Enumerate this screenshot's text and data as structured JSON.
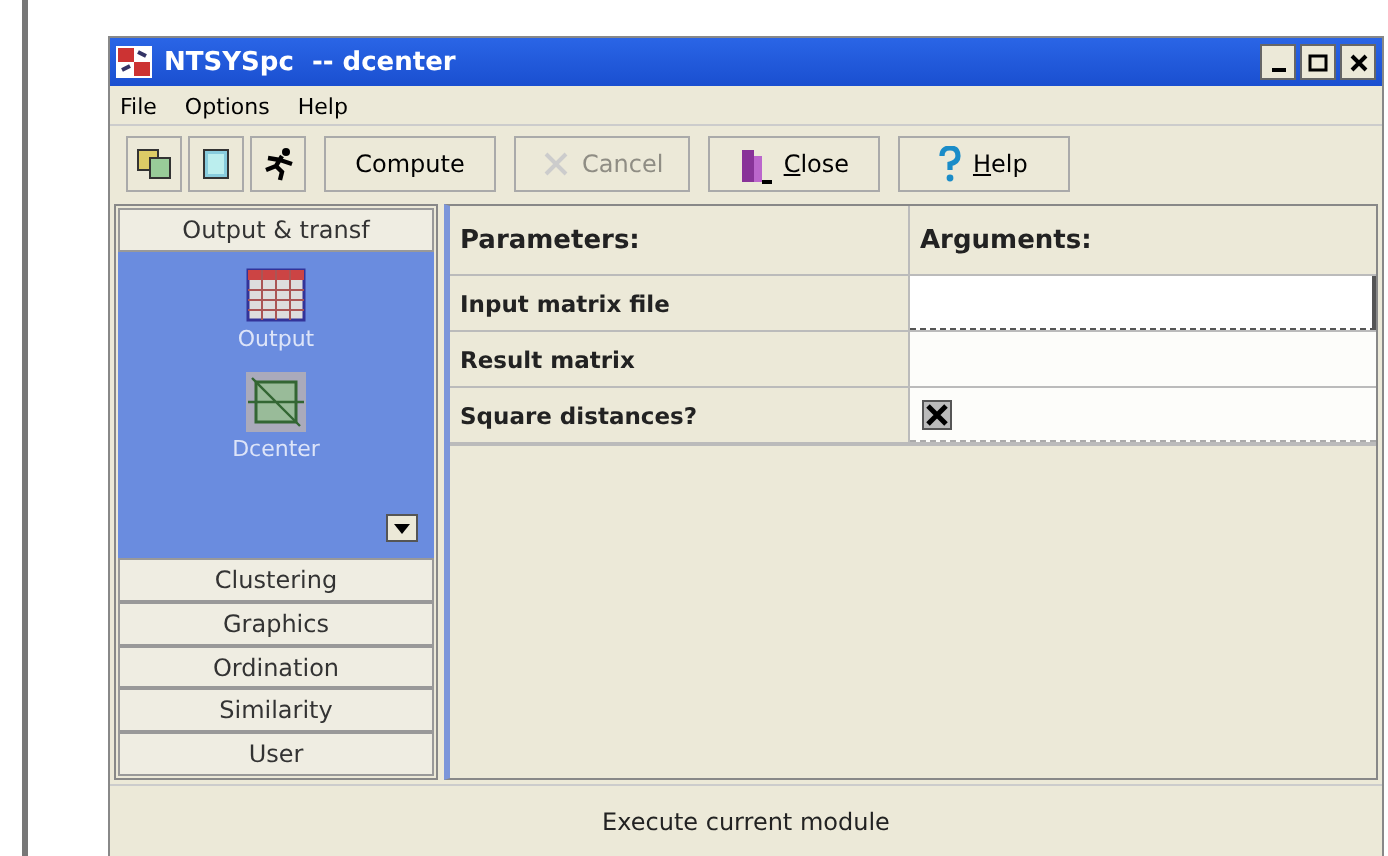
{
  "window": {
    "title": "NTSYSpc  -- dcenter"
  },
  "menu": [
    "File",
    "Options",
    "Help"
  ],
  "toolbar": {
    "icon_buttons": [
      {
        "kind": "copy"
      },
      {
        "kind": "notes"
      },
      {
        "kind": "run"
      }
    ],
    "buttons": [
      {
        "label": "Compute",
        "kind": "plain",
        "disabled": false,
        "underline_first": false
      },
      {
        "label": "Cancel",
        "kind": "cancel",
        "disabled": true,
        "underline_first": false
      },
      {
        "label": "Close",
        "kind": "close",
        "disabled": false,
        "underline_first": true
      },
      {
        "label": "Help",
        "kind": "help",
        "disabled": false,
        "underline_first": true
      }
    ]
  },
  "sidebar": {
    "groups": [
      {
        "label": "Output & transf",
        "expanded": true,
        "items": [
          {
            "label": "Output",
            "kind": "grid"
          },
          {
            "label": "Dcenter",
            "kind": "dcenter"
          }
        ]
      },
      {
        "label": "Clustering",
        "expanded": false
      },
      {
        "label": "Graphics",
        "expanded": false
      },
      {
        "label": "Ordination",
        "expanded": false
      },
      {
        "label": "Similarity",
        "expanded": false
      },
      {
        "label": "User",
        "expanded": false
      }
    ]
  },
  "table": {
    "columns": [
      "Parameters:",
      "Arguments:"
    ],
    "rows": [
      {
        "parameter": "Input matrix file",
        "kind": "field",
        "focused": true
      },
      {
        "parameter": "Result matrix",
        "kind": "field",
        "focused": false
      },
      {
        "parameter": "Square distances?",
        "kind": "checkbox",
        "checked": true
      }
    ]
  },
  "status_bar": "Execute current module"
}
